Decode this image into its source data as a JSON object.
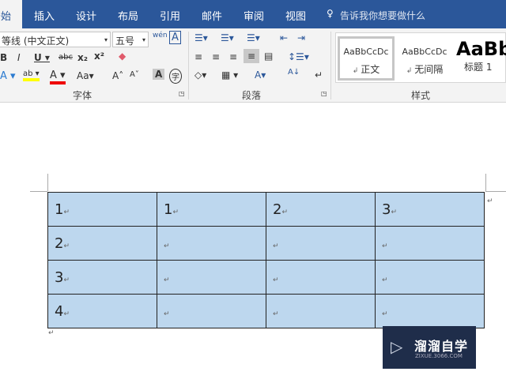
{
  "tabs": [
    "开始",
    "插入",
    "设计",
    "布局",
    "引用",
    "邮件",
    "审阅",
    "视图"
  ],
  "tell_me": "告诉我你想要做什么",
  "font": {
    "name": "等线 (中文正文)",
    "size": "五号",
    "group_label": "字体"
  },
  "paragraph": {
    "group_label": "段落"
  },
  "styles": {
    "group_label": "样式",
    "items": [
      {
        "preview": "AaBbCcDc",
        "name": "正文"
      },
      {
        "preview": "AaBbCcDc",
        "name": "无间隔"
      },
      {
        "preview": "AaBb",
        "name": "标题 1"
      }
    ]
  },
  "table": [
    [
      "1",
      "1",
      "2",
      "3"
    ],
    [
      "2",
      "",
      "",
      ""
    ],
    [
      "3",
      "",
      "",
      ""
    ],
    [
      "4",
      "",
      "",
      ""
    ]
  ],
  "watermark": {
    "name": "溜溜自学",
    "url": "ZIXUE.3066.COM"
  }
}
